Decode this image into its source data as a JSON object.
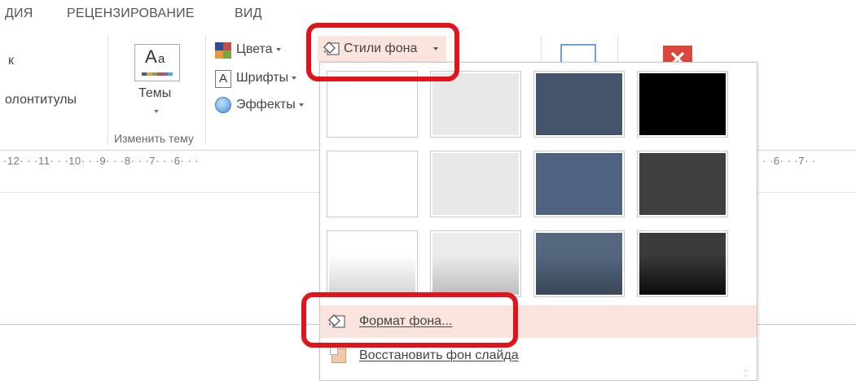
{
  "ribbon_tabs": {
    "partial": "ДИЯ",
    "review": "РЕЦЕНЗИРОВАНИЕ",
    "view": "ВИД"
  },
  "ribbon": {
    "left_fragment_1": "к",
    "left_fragment_2": "олонтитулы",
    "themes_label": "Темы",
    "colors_label": "Цвета",
    "fonts_label": "Шрифты",
    "effects_label": "Эффекты",
    "background_styles_label": "Стили фона",
    "change_theme_group": "Изменить тему"
  },
  "ruler": {
    "left_marks": "·12· · ·11· · ·10· · ·9· · ·8· · ·7· · ·6· · ·",
    "right_marks": "· ·6· · ·7· ·"
  },
  "dropdown": {
    "tiles": [
      {
        "color": "#ffffff",
        "gradient": false
      },
      {
        "color": "#e8e8e8",
        "gradient": false
      },
      {
        "color": "#44546a",
        "gradient": false
      },
      {
        "color": "#000000",
        "gradient": false
      },
      {
        "color": "#ffffff",
        "gradient": false
      },
      {
        "color": "#e9e7e7",
        "gradient": false
      },
      {
        "color": "#4f6381",
        "gradient": false
      },
      {
        "color": "#404040",
        "gradient": false
      },
      {
        "color": "#ffffff",
        "gradient": true,
        "end": "#d4d4d4"
      },
      {
        "color": "#ececec",
        "gradient": true,
        "end": "#bdbdbd"
      },
      {
        "color": "#55667f",
        "gradient": true,
        "end": "#3a4759"
      },
      {
        "color": "#3b3b3b",
        "gradient": true,
        "end": "#0c0c0c"
      }
    ],
    "format_background": "Формат фона...",
    "reset_background": "Восстановить фон слайда"
  },
  "colors": {
    "highlight": "#fbe3de",
    "annotation_red": "#e0141b"
  }
}
